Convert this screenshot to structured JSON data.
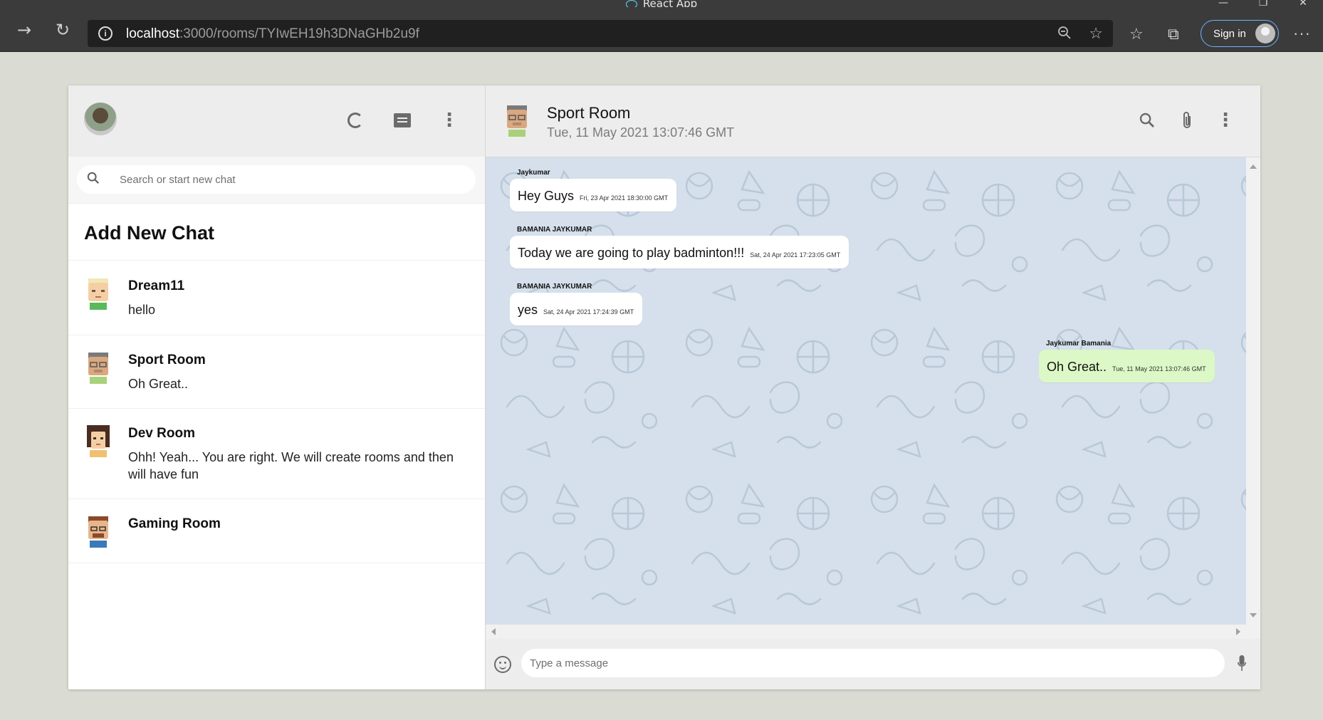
{
  "browser": {
    "title": "React App",
    "url_host": "localhost",
    "url_rest": ":3000/rooms/TYIwEH19h3DNaGHb2u9f",
    "signin_label": "Sign in",
    "icons": [
      "back-icon",
      "refresh-icon",
      "info-icon",
      "zoom-out-icon",
      "add-favorite-icon",
      "favorites-icon",
      "collections-icon",
      "more-icon"
    ]
  },
  "sidebar": {
    "search_placeholder": "Search or start new chat",
    "add_new_chat": "Add New Chat",
    "chats": [
      {
        "name": "Dream11",
        "last_message": "hello"
      },
      {
        "name": "Sport Room",
        "last_message": "Oh Great.."
      },
      {
        "name": "Dev Room",
        "last_message": "Ohh! Yeah... You are right. We will create rooms and then will have fun"
      },
      {
        "name": "Gaming Room",
        "last_message": ""
      }
    ]
  },
  "chat": {
    "room_name": "Sport Room",
    "last_seen": "Tue, 11 May 2021 13:07:46 GMT",
    "messages": [
      {
        "sender": "Jaykumar",
        "text": "Hey Guys",
        "timestamp": "Fri, 23 Apr 2021 18:30:00 GMT",
        "mine": false
      },
      {
        "sender": "BAMANIA JAYKUMAR",
        "text": "Today we are going to play badminton!!!",
        "timestamp": "Sat, 24 Apr 2021 17:23:05 GMT",
        "mine": false
      },
      {
        "sender": "BAMANIA JAYKUMAR",
        "text": "yes",
        "timestamp": "Sat, 24 Apr 2021 17:24:39 GMT",
        "mine": false
      },
      {
        "sender": "Jaykumar Bamania",
        "text": "Oh Great..",
        "timestamp": "Tue, 11 May 2021 13:07:46 GMT",
        "mine": true
      }
    ],
    "input_placeholder": "Type a message"
  },
  "colors": {
    "sent_bubble": "#dcf8c6",
    "received_bubble": "#ffffff",
    "chat_background": "#d5e0ec",
    "header_background": "#ededed"
  }
}
